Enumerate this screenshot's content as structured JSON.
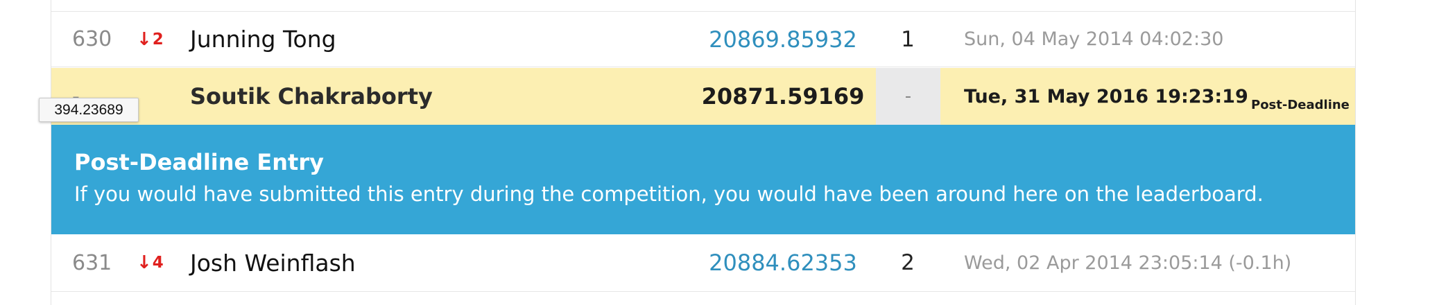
{
  "colors": {
    "score_link": "#2f8fbd",
    "rank_drop": "#e0201e",
    "highlight_row": "#fcefb2",
    "banner": "#35a6d6"
  },
  "rows": [
    {
      "rank": "630",
      "change_icon": "arrow-down-icon",
      "change": "2",
      "team": "Junning Tong",
      "score": "20869.85932",
      "entries": "1",
      "last_submission": "Sun, 04 May 2014 04:02:30"
    },
    {
      "rank": "-",
      "team": "Soutik Chakraborty",
      "score": "20871.59169",
      "entries": "-",
      "last_submission": "Tue, 31 May 2016 19:23:19",
      "tag": "Post-Deadline"
    },
    {
      "rank": "631",
      "change_icon": "arrow-down-icon",
      "change": "4",
      "team": "Josh Weinflash",
      "score": "20884.62353",
      "entries": "2",
      "last_submission": "Wed, 02 Apr 2014 23:05:14 (-0.1h)"
    }
  ],
  "banner": {
    "title": "Post-Deadline Entry",
    "text": "If you would have submitted this entry during the competition, you would have been around here on the leaderboard."
  },
  "tooltip": {
    "text": "394.23689"
  }
}
